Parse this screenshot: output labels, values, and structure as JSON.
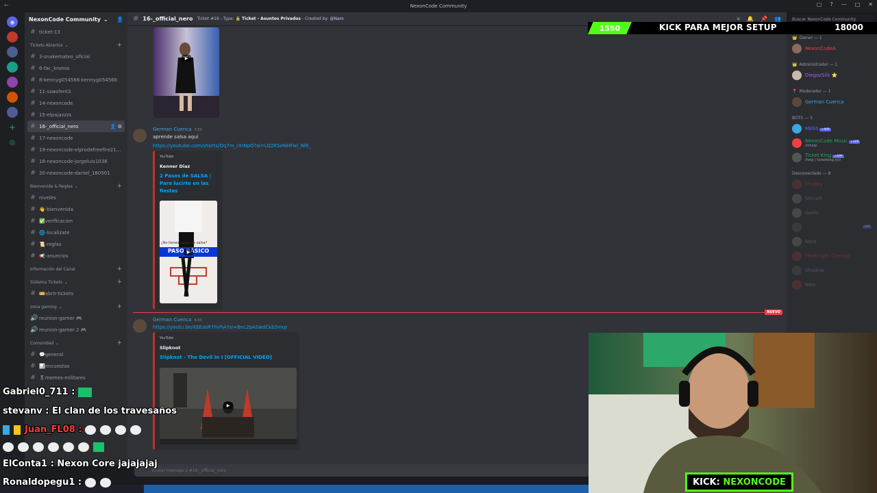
{
  "titlebar": {
    "title": "NexonCode Community"
  },
  "server": {
    "name": "NexonCode Community"
  },
  "sidebar": {
    "top_channel": "ticket-13",
    "categories": [
      {
        "name": "Tickets Abiertos",
        "channels": [
          "3-snakemateo_oficial",
          "6-fac_kronos",
          "8-kennyg054566-kennyg054566",
          "11-sswsfent3",
          "14-nexoncode",
          "15-elpajazzzs",
          "16-_official_nero",
          "17-nexoncode",
          "19-nexoncode-elprodefreefire21...",
          "18-nexoncode-jorgeluis1038",
          "20-nexoncode-daniel_180501"
        ]
      },
      {
        "name": "Bienvenida & Reglas",
        "channels": [
          "niveles",
          "👋-bienvenida",
          "✅verificacion",
          "🌐-localizate",
          "📜-reglas",
          "📢-anuncios"
        ]
      },
      {
        "name": "Información del Canal",
        "channels": []
      },
      {
        "name": "Sistema Tickets",
        "channels": [
          "🎫abrir-tickets"
        ]
      },
      {
        "name": "zona gaming",
        "channels": [
          "reunion-gamer 🎮",
          "reunion-gamer 2 🎮"
        ]
      },
      {
        "name": "Comunidad",
        "channels": [
          "💬general",
          "📊encuestas",
          "🎖memes-militares"
        ]
      }
    ]
  },
  "channel": {
    "name": "16-_official_nero",
    "topic_prefix": "Ticket #16 - Type:",
    "topic_type": "🔒 Ticket - Asuntos Privados",
    "topic_created": "- Created by:",
    "topic_mention": "@Naro"
  },
  "messages": [
    {
      "author": "German Cuenca",
      "time": "3:50",
      "text": "aprende salsa aquí",
      "link": "https://youtube.com/shorts/Oq7m_clnNpO?si=LQ2KSeNHFwi_Nl8_",
      "embed": {
        "provider": "YouTube",
        "author": "Kenner Diaz",
        "title": "2 Pasos de SALSA | Para lucirte en las fiestas",
        "thumb_caption": "PASO BÁSICO",
        "thumb_sub": "¿No tienes pasos de salsa?"
      }
    },
    {
      "author": "German Cuenca",
      "time": "4:03",
      "link": "https://youtu.be/XEEasR7hVhA?si=Bec2bASwdCkb5mqr",
      "embed": {
        "provider": "YouTube",
        "author": "Slipknot",
        "title": "Slipknot - The Devil In I [OFFICIAL VIDEO]"
      }
    }
  ],
  "new_badge": "NUEVO",
  "input": {
    "placeholder": "Enviar mensaje a #16-_official_nero"
  },
  "members": {
    "search_placeholder": "Buscar NexonCode Community",
    "groups": [
      {
        "label": "Owner — 1",
        "items": [
          {
            "name": "NexonCodeA",
            "color": "#f23f43"
          }
        ]
      },
      {
        "label": "Administrador — 1",
        "items": [
          {
            "name": "DiegozSlik ⭐",
            "color": "#a55ff2"
          }
        ]
      },
      {
        "label": "Moderador — 1",
        "items": [
          {
            "name": "German Cuenca",
            "color": "#3ba7e3"
          }
        ]
      },
      {
        "label": "BOTS — 3",
        "items": [
          {
            "name": "MEE6",
            "sub": "",
            "color": "#5865f2"
          },
          {
            "name": "NexonCode Music",
            "sub": "/mhelp",
            "color": "#23a55a"
          },
          {
            "name": "Ticket King",
            "sub": "/help | ticketking.xyz",
            "color": "#23a55a"
          }
        ]
      },
      {
        "label": "Desconectado — 8",
        "items": [
          {
            "name": "Shoppy",
            "color": "#f23f43"
          },
          {
            "name": "Sincalli",
            "color": "#949ba4"
          },
          {
            "name": "Gaelo",
            "color": "#949ba4"
          },
          {
            "name": "",
            "color": "#5865f2"
          },
          {
            "name": "Nero",
            "color": "#949ba4"
          },
          {
            "name": "TheKnight Gaming",
            "color": "#f23f43"
          },
          {
            "name": "Shadow",
            "color": "#949ba4"
          },
          {
            "name": "Niko",
            "color": "#949ba4"
          }
        ]
      }
    ]
  },
  "overlay": {
    "kick_goal_left": "1550",
    "kick_goal_text": "KICK PARA MEJOR SETUP",
    "kick_goal_right": "18000",
    "kick_label_prefix": "KICK:",
    "kick_label_name": "NEXONCODE",
    "chat": [
      {
        "user": "Gabriel0_711 :",
        "text": ""
      },
      {
        "user": "stevanv :",
        "text": "El clan de los travesaños"
      },
      {
        "user": "Juan_FL08 :",
        "text": ""
      },
      {
        "user": "ElConta1 :",
        "text": "Nexon Core jajajajaj"
      },
      {
        "user": "Ronaldopegu1 :",
        "text": ""
      }
    ]
  }
}
